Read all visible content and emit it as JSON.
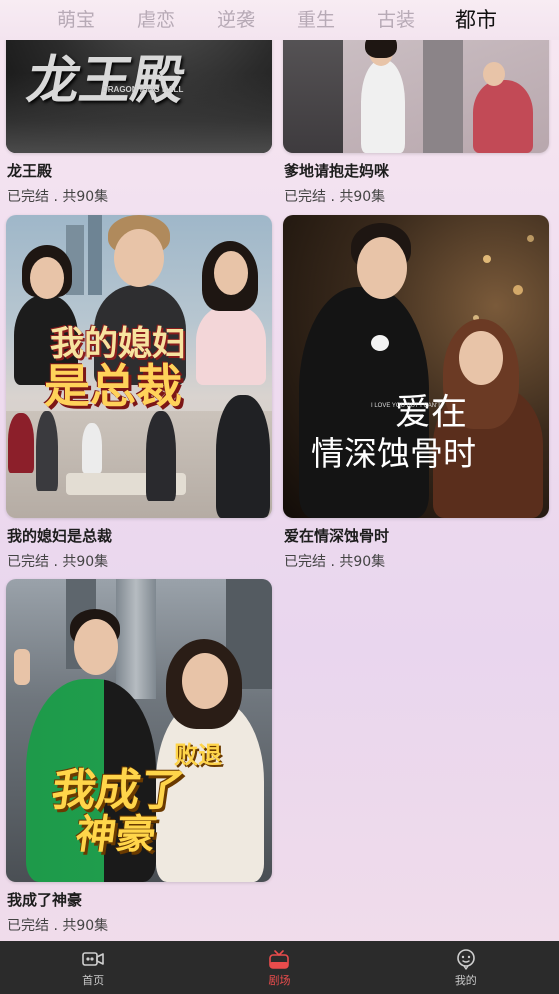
{
  "tabs": [
    {
      "label": "萌宝",
      "active": false
    },
    {
      "label": "虐恋",
      "active": false
    },
    {
      "label": "逆袭",
      "active": false
    },
    {
      "label": "重生",
      "active": false
    },
    {
      "label": "古装",
      "active": false
    },
    {
      "label": "都市",
      "active": true
    }
  ],
  "cards": [
    {
      "title": "龙王殿",
      "status": "已完结 . 共90集",
      "poster_title": "龙王殿",
      "poster_subtitle": "DRAGON KING HALL"
    },
    {
      "title": "爹地请抱走妈咪",
      "status": "已完结 . 共90集"
    },
    {
      "title": "我的媳妇是总裁",
      "status": "已完结 . 共90集",
      "poster_title_line1": "我的媳妇",
      "poster_title_line2": "是总裁"
    },
    {
      "title": "爱在情深蚀骨时",
      "status": "已完结 . 共90集",
      "poster_title_line1": "爱在",
      "poster_title_line2": "情深蚀骨时",
      "poster_small": "I LOVE YOU BUT I CAN'T"
    },
    {
      "title": "我成了神豪",
      "status": "已完结 . 共90集",
      "poster_title_line1": "败退",
      "poster_title_line2": "我成了",
      "poster_title_line3": "神豪"
    }
  ],
  "nav": [
    {
      "label": "首页",
      "icon": "video-camera-icon",
      "active": false
    },
    {
      "label": "剧场",
      "icon": "tv-icon",
      "active": true
    },
    {
      "label": "我的",
      "icon": "profile-face-icon",
      "active": false
    }
  ],
  "colors": {
    "active_nav": "#e94c4c",
    "nav_bg": "#2b2b2b",
    "tab_active": "#111111",
    "tab_inactive": "#b7aab6"
  }
}
